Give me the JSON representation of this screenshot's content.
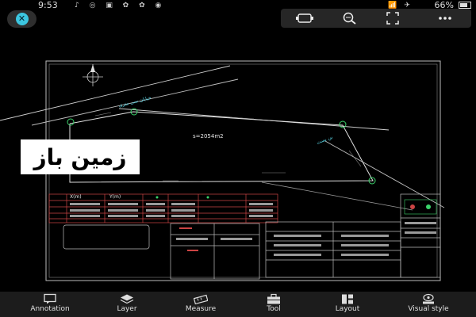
{
  "status_bar": {
    "time": "9:53",
    "notification_icons": "♪ ◎ ▣ ✿ ✿ ◉",
    "signal_icons": "📶 ✈",
    "battery": "66%"
  },
  "top_controls": {
    "close_icon": "close-icon",
    "toolbar_icons": [
      "layers-toggle-icon",
      "zoom-search-icon",
      "fullscreen-icon",
      "more-icon"
    ],
    "accent": "#3cc6e0"
  },
  "drawing": {
    "area_label": "s=2054m2",
    "road_label_top": "خیابان سی متری",
    "road_label_right": "بن بست",
    "table_header": {
      "x": "X(m)",
      "y": "Y(m)"
    },
    "watermark": "زمین باز"
  },
  "bottom_nav": {
    "items": [
      {
        "label": "Annotation",
        "icon": "annotation-icon"
      },
      {
        "label": "Layer",
        "icon": "layer-icon"
      },
      {
        "label": "Measure",
        "icon": "measure-icon"
      },
      {
        "label": "Tool",
        "icon": "toolbox-icon"
      },
      {
        "label": "Layout",
        "icon": "layout-icon"
      },
      {
        "label": "Visual style",
        "icon": "visual-style-icon"
      }
    ]
  }
}
